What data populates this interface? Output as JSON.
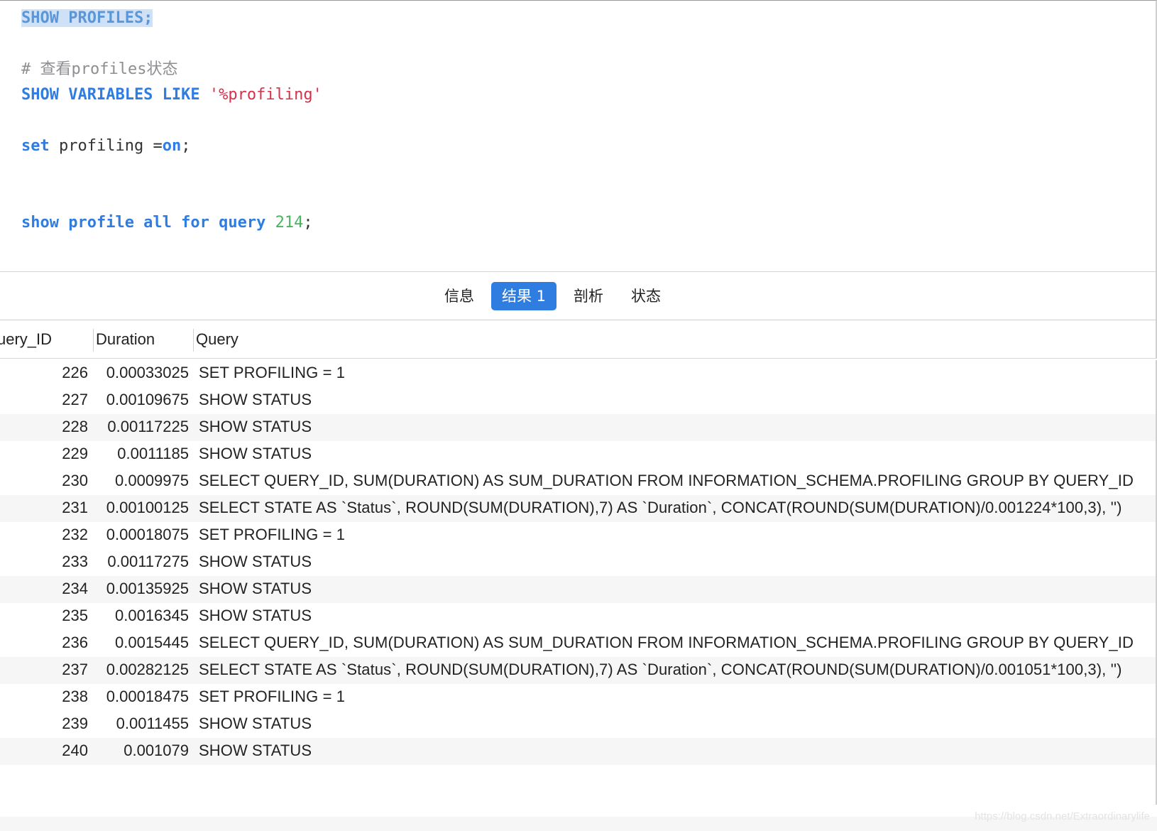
{
  "editor": {
    "line1": "SHOW PROFILES;",
    "comment": "# 查看profiles状态",
    "line2_kw": "SHOW VARIABLES LIKE",
    "line2_str": "'%profiling'",
    "line3_kw": "set",
    "line3_plain": "profiling =",
    "line3_on": "on",
    "line3_end": ";",
    "line4_kw": "show profile all for query",
    "line4_num": "214",
    "line4_end": ";"
  },
  "tabs": [
    {
      "label": "信息",
      "active": false
    },
    {
      "label": "结果 1",
      "active": true
    },
    {
      "label": "剖析",
      "active": false
    },
    {
      "label": "状态",
      "active": false
    }
  ],
  "table": {
    "columns": [
      "uery_ID",
      "Duration",
      "Query"
    ],
    "rows": [
      {
        "id": "226",
        "duration": "0.00033025",
        "query": "SET PROFILING = 1"
      },
      {
        "id": "227",
        "duration": "0.00109675",
        "query": "SHOW STATUS"
      },
      {
        "id": "228",
        "duration": "0.00117225",
        "query": "SHOW STATUS"
      },
      {
        "id": "229",
        "duration": "0.0011185",
        "query": "SHOW STATUS"
      },
      {
        "id": "230",
        "duration": "0.0009975",
        "query": "SELECT QUERY_ID, SUM(DURATION) AS SUM_DURATION FROM INFORMATION_SCHEMA.PROFILING GROUP BY QUERY_ID"
      },
      {
        "id": "231",
        "duration": "0.00100125",
        "query": "SELECT STATE AS `Status`, ROUND(SUM(DURATION),7) AS `Duration`, CONCAT(ROUND(SUM(DURATION)/0.001224*100,3), '')"
      },
      {
        "id": "232",
        "duration": "0.00018075",
        "query": "SET PROFILING = 1"
      },
      {
        "id": "233",
        "duration": "0.00117275",
        "query": "SHOW STATUS"
      },
      {
        "id": "234",
        "duration": "0.00135925",
        "query": "SHOW STATUS"
      },
      {
        "id": "235",
        "duration": "0.0016345",
        "query": "SHOW STATUS"
      },
      {
        "id": "236",
        "duration": "0.0015445",
        "query": "SELECT QUERY_ID, SUM(DURATION) AS SUM_DURATION FROM INFORMATION_SCHEMA.PROFILING GROUP BY QUERY_ID"
      },
      {
        "id": "237",
        "duration": "0.00282125",
        "query": "SELECT STATE AS `Status`, ROUND(SUM(DURATION),7) AS `Duration`, CONCAT(ROUND(SUM(DURATION)/0.001051*100,3), '')"
      },
      {
        "id": "238",
        "duration": "0.00018475",
        "query": "SET PROFILING = 1"
      },
      {
        "id": "239",
        "duration": "0.0011455",
        "query": "SHOW STATUS"
      },
      {
        "id": "240",
        "duration": "0.001079",
        "query": "SHOW STATUS"
      }
    ]
  },
  "watermark": "https://blog.csdn.net/Extraordinarylife",
  "colors": {
    "accent": "#2f7de1",
    "string": "#d8304a",
    "number": "#49b35f",
    "comment": "#8e8e93"
  }
}
